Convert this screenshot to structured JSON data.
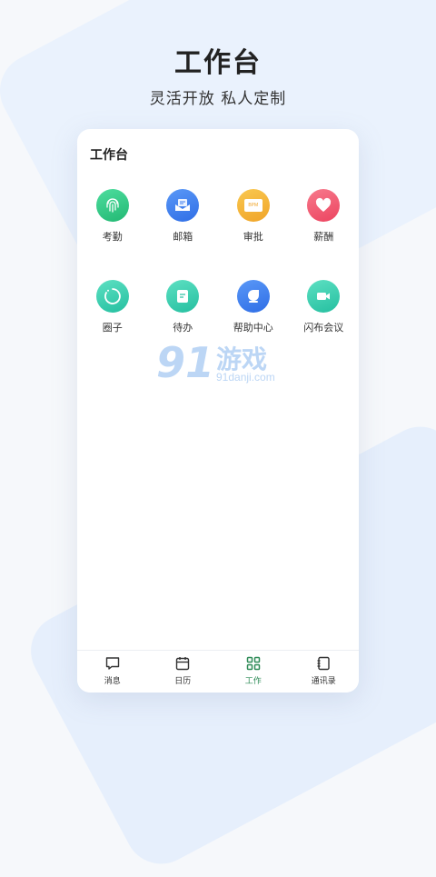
{
  "hero": {
    "title": "工作台",
    "subtitle": "灵活开放 私人定制"
  },
  "workbench": {
    "title": "工作台",
    "apps": [
      {
        "label": "考勤",
        "icon": "fingerprint-icon",
        "color": "#2fc78a"
      },
      {
        "label": "邮箱",
        "icon": "mail-icon",
        "color": "#3d7ef0"
      },
      {
        "label": "审批",
        "icon": "bpm-icon",
        "color": "#f4b63a",
        "badge": "BPM"
      },
      {
        "label": "薪酬",
        "icon": "heart-icon",
        "color": "#f0566d"
      },
      {
        "label": "圈子",
        "icon": "circle-icon",
        "color": "#3bd0b0"
      },
      {
        "label": "待办",
        "icon": "todo-icon",
        "color": "#3bd0b0"
      },
      {
        "label": "帮助中心",
        "icon": "help-icon",
        "color": "#3d7ef0"
      },
      {
        "label": "闪布会议",
        "icon": "video-icon",
        "color": "#3bd0b0"
      }
    ]
  },
  "watermark": {
    "digits": "91",
    "cn": "游戏",
    "url": "91danji.com"
  },
  "tabbar": {
    "items": [
      {
        "label": "消息",
        "icon": "message-icon",
        "active": false
      },
      {
        "label": "日历",
        "icon": "calendar-icon",
        "active": false
      },
      {
        "label": "工作",
        "icon": "grid-icon",
        "active": true
      },
      {
        "label": "通讯录",
        "icon": "contacts-icon",
        "active": false
      }
    ],
    "active_color": "#2e8b57",
    "inactive_color": "#333333"
  }
}
